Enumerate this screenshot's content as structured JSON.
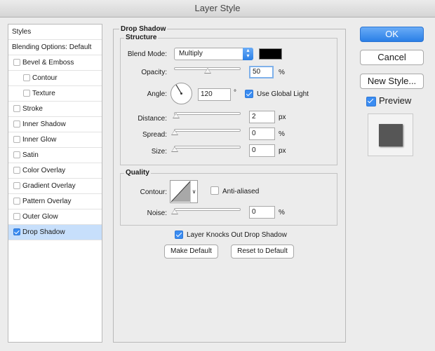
{
  "window": {
    "title": "Layer Style"
  },
  "styles_list": {
    "header": "Styles",
    "blending": "Blending Options: Default",
    "items": [
      {
        "label": "Bevel & Emboss",
        "checked": false,
        "indent": 0
      },
      {
        "label": "Contour",
        "checked": false,
        "indent": 1
      },
      {
        "label": "Texture",
        "checked": false,
        "indent": 1
      },
      {
        "label": "Stroke",
        "checked": false,
        "indent": 0
      },
      {
        "label": "Inner Shadow",
        "checked": false,
        "indent": 0
      },
      {
        "label": "Inner Glow",
        "checked": false,
        "indent": 0
      },
      {
        "label": "Satin",
        "checked": false,
        "indent": 0
      },
      {
        "label": "Color Overlay",
        "checked": false,
        "indent": 0
      },
      {
        "label": "Gradient Overlay",
        "checked": false,
        "indent": 0
      },
      {
        "label": "Pattern Overlay",
        "checked": false,
        "indent": 0
      },
      {
        "label": "Outer Glow",
        "checked": false,
        "indent": 0
      },
      {
        "label": "Drop Shadow",
        "checked": true,
        "indent": 0
      }
    ]
  },
  "drop_shadow": {
    "title": "Drop Shadow",
    "structure": {
      "title": "Structure",
      "blend_mode_label": "Blend Mode:",
      "blend_mode_value": "Multiply",
      "shadow_color": "#000000",
      "opacity_label": "Opacity:",
      "opacity_value": "50",
      "opacity_unit": "%",
      "opacity_fraction": 0.5,
      "angle_label": "Angle:",
      "angle_value": "120",
      "angle_unit": "°",
      "use_global_light_label": "Use Global Light",
      "use_global_light": true,
      "distance_label": "Distance:",
      "distance_value": "2",
      "distance_unit": "px",
      "spread_label": "Spread:",
      "spread_value": "0",
      "spread_unit": "%",
      "size_label": "Size:",
      "size_value": "0",
      "size_unit": "px"
    },
    "quality": {
      "title": "Quality",
      "contour_label": "Contour:",
      "anti_aliased_label": "Anti-aliased",
      "anti_aliased": false,
      "noise_label": "Noise:",
      "noise_value": "0",
      "noise_unit": "%"
    },
    "knocks_out_label": "Layer Knocks Out Drop Shadow",
    "knocks_out": true,
    "make_default_label": "Make Default",
    "reset_default_label": "Reset to Default"
  },
  "actions": {
    "ok": "OK",
    "cancel": "Cancel",
    "new_style": "New Style...",
    "preview_label": "Preview",
    "preview_checked": true
  },
  "colors": {
    "accent": "#3a8cf2",
    "selection": "#c7dffb"
  }
}
